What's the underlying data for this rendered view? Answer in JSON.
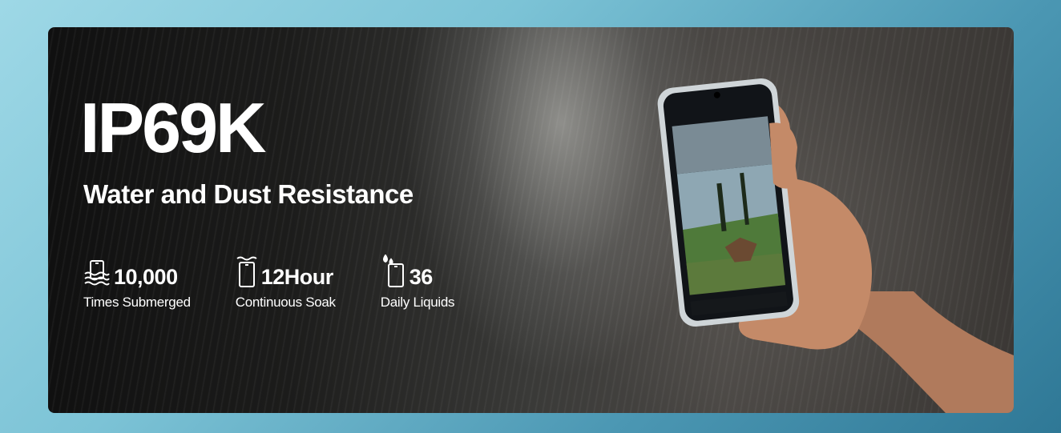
{
  "banner": {
    "title": "IP69K",
    "subtitle": "Water and Dust Resistance",
    "stats": [
      {
        "icon": "submerged-phone-icon",
        "value": "10,000",
        "label": "Times Submerged"
      },
      {
        "icon": "soaking-phone-icon",
        "value": "12Hour",
        "label": "Continuous Soak"
      },
      {
        "icon": "liquid-drop-phone-icon",
        "value": "36",
        "label": "Daily Liquids"
      }
    ]
  },
  "colors": {
    "text": "#ffffff",
    "frame_gradient_start": "#9ed8e6",
    "frame_gradient_end": "#2f7896",
    "banner_dark": "#101010"
  }
}
